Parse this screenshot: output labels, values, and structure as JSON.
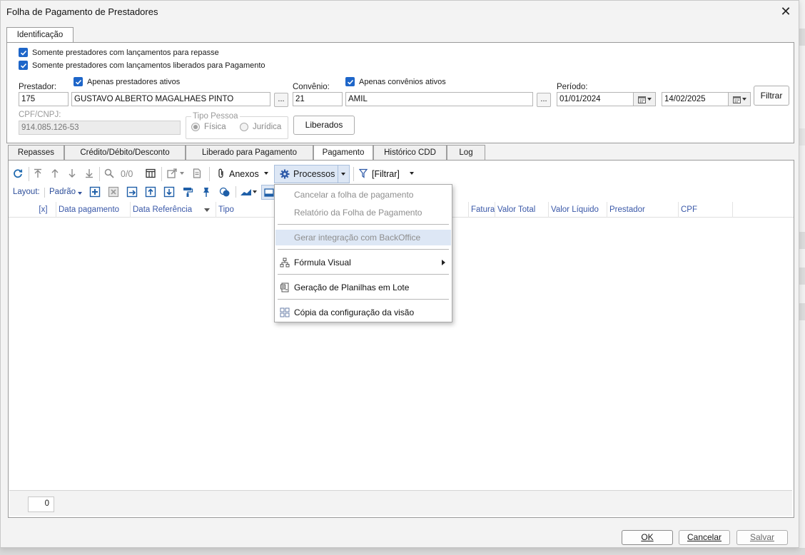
{
  "window": {
    "title": "Folha de Pagamento de Prestadores",
    "close_glyph": "✕"
  },
  "ident_tab": {
    "label": "Identificação"
  },
  "filters": {
    "check_repasse": "Somente prestadores com lançamentos para repasse",
    "check_liberados": "Somente prestadores com lançamentos liberados para Pagamento",
    "prestador_label": "Prestador:",
    "apenas_prestadores_ativos": "Apenas prestadores ativos",
    "prestador_code": "175",
    "prestador_name": "GUSTAVO ALBERTO MAGALHAES PINTO",
    "convenio_label": "Convênio:",
    "apenas_convenios_ativos": "Apenas convênios ativos",
    "convenio_code": "21",
    "convenio_name": "AMIL",
    "periodo_label": "Período:",
    "periodo_inicio": "01/01/2024",
    "periodo_fim": "14/02/2025",
    "filtrar_button": "Filtrar",
    "ellipsis": "...",
    "cpf_label": "CPF/CNPJ:",
    "cpf_value": "914.085.126-53",
    "tipo_pessoa_label": "Tipo Pessoa",
    "tipo_fisica": "Física",
    "tipo_juridica": "Jurídica",
    "liberados_button": "Liberados"
  },
  "tabs": [
    {
      "label": "Repasses"
    },
    {
      "label": "Crédito/Débito/Desconto"
    },
    {
      "label": "Liberado para Pagamento"
    },
    {
      "label": "Pagamento"
    },
    {
      "label": "Histórico CDD"
    },
    {
      "label": "Log"
    }
  ],
  "active_tab": "Pagamento",
  "toolbar": {
    "record_counter": "0/0",
    "anexos": "Anexos",
    "processos": "Processos",
    "filtrar": "[Filtrar]"
  },
  "layout_bar": {
    "label": "Layout:",
    "layout_value": "Padrão"
  },
  "columns": [
    "[x]",
    "Data pagamento",
    "Data Referência",
    "Tipo",
    "Fatura",
    "Valor Total",
    "Valor Líquido",
    "Prestador",
    "CPF"
  ],
  "status": {
    "count": "0"
  },
  "processos_menu": {
    "items": [
      {
        "label": "Cancelar a folha de pagamento",
        "disabled": true
      },
      {
        "label": "Relatório da Folha de Pagamento",
        "disabled": true
      },
      {
        "label": "Gerar integração com BackOffice",
        "disabled": true,
        "highlighted": true
      },
      {
        "label": "Fórmula Visual",
        "submenu": true
      },
      {
        "label": "Geração de Planilhas em Lote"
      },
      {
        "label": "Cópia da configuração da visão"
      }
    ]
  },
  "footer": {
    "ok": "OK",
    "cancelar": "Cancelar",
    "salvar": "Salvar"
  },
  "colors": {
    "accent": "#1e66c9",
    "header_text": "#3a58a8",
    "menu_highlight": "#dde7f5"
  }
}
